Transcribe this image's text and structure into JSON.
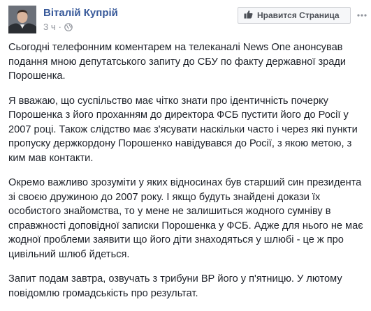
{
  "post": {
    "author": "Віталій Купрій",
    "time": "3 ч",
    "separator": "·",
    "privacy_icon": "globe-icon",
    "like_page_label": "Нравится Страница",
    "like_icon": "thumbs-up-icon",
    "more_icon": "more-options-icon",
    "paragraphs": [
      "Сьогодні телефонним коментарем на телеканалі News One анонсував подання мною депутатського запиту до СБУ по факту державної зради Порошенка.",
      "Я вважаю, що суспільство має чітко знати про ідентичність почерку Порошенка з його проханням до директора ФСБ пустити його до Росії у 2007 році. Також слідство має з'ясувати наскільки часто і через які пункти пропуску держкордону Порошенко навідувався до Росії, з якою метою, з ким мав контакти.",
      "Окремо важливо зрозуміти у яких відносинах був старший син президента зі своєю дружиною до 2007 року. І якщо будуть знайдені докази їх особистого знайомства, то у мене не залишиться жодного сумніву в справжності доповідної записки Порошенка у ФСБ. Адже для нього не має жодної проблеми заявити що його діти знаходяться у шлюбі - це ж про цивільний шлюб йдеться.",
      "Запит подам завтра, озвучать з трибуни ВР його у п'ятницю. У лютому повідомлю громадськість про результат."
    ]
  },
  "colors": {
    "link": "#365899",
    "meta": "#90949c",
    "text": "#1d2129",
    "button_bg": "#f6f7f9",
    "button_border": "#ced0d4"
  }
}
